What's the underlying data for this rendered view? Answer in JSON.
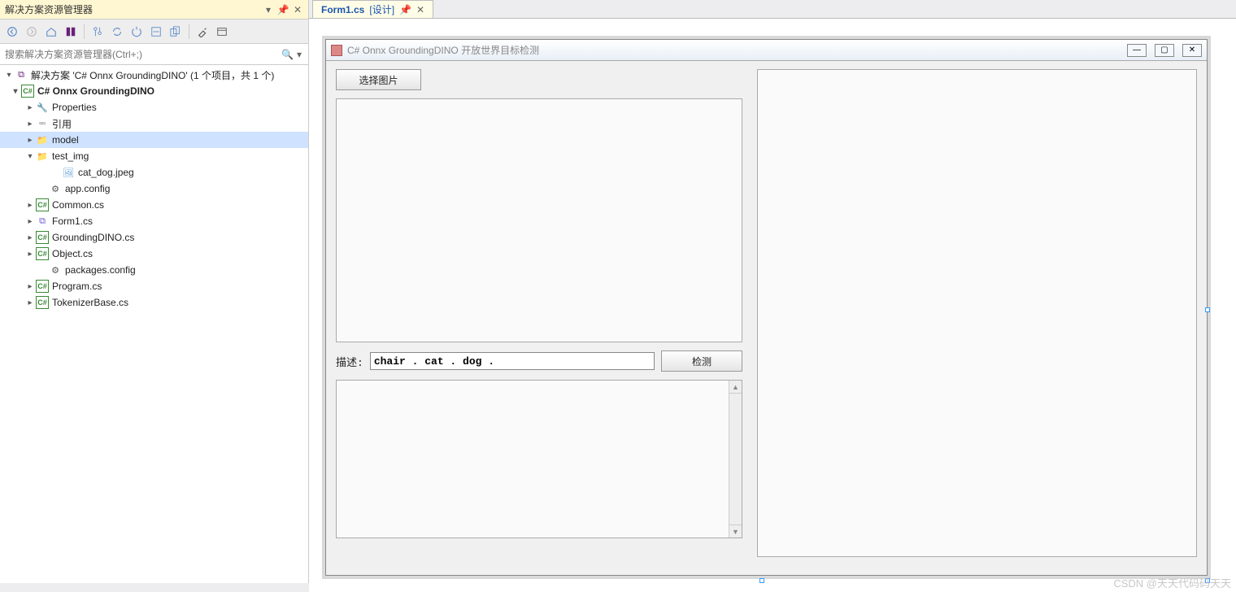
{
  "panel": {
    "title": "解决方案资源管理器",
    "search_placeholder": "搜索解决方案资源管理器(Ctrl+;)"
  },
  "tree": {
    "solution": "解决方案 'C# Onnx GroundingDINO' (1 个项目，共 1 个)",
    "project": "C# Onnx GroundingDINO",
    "properties": "Properties",
    "references": "引用",
    "folder_model": "model",
    "folder_testimg": "test_img",
    "file_catdog": "cat_dog.jpeg",
    "file_appconfig": "app.config",
    "file_common": "Common.cs",
    "file_form1": "Form1.cs",
    "file_grounding": "GroundingDINO.cs",
    "file_object": "Object.cs",
    "file_packages": "packages.config",
    "file_program": "Program.cs",
    "file_tokenizer": "TokenizerBase.cs"
  },
  "tab": {
    "name": "Form1.cs",
    "suffix": "[设计]"
  },
  "form": {
    "title": "C# Onnx GroundingDINO 开放世界目标检测",
    "select_image": "选择图片",
    "desc_label": "描述:",
    "desc_value": "chair . cat . dog .",
    "detect": "检测"
  },
  "watermark": "CSDN @天天代码码天天"
}
